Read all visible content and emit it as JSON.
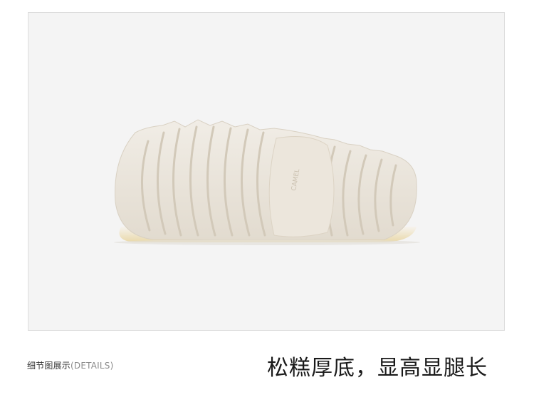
{
  "photo": {
    "subject": "sandal-sole",
    "sole_imprint": "CAMEL"
  },
  "caption": {
    "section_label": "细节图展示",
    "section_label_en": "(DETAILS)"
  },
  "headline": {
    "text": "松糕厚底，显高显腿长"
  },
  "colors": {
    "background": "#f4f4f4",
    "sole": "#ece6dc",
    "text": "#1a1a1a",
    "muted": "#8a8a8a"
  }
}
